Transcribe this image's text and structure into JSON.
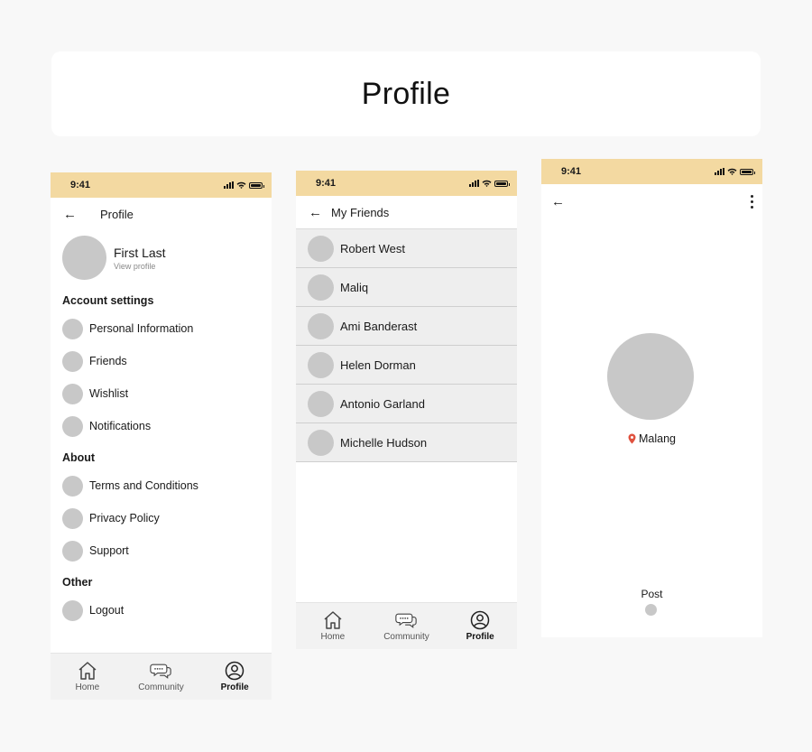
{
  "page": {
    "title": "Profile"
  },
  "status_bar": {
    "time": "9:41"
  },
  "profile_screen": {
    "header_title": "Profile",
    "user_name": "First Last",
    "view_profile": "View profile",
    "sections": [
      {
        "title": "Account settings",
        "items": [
          "Personal Information",
          "Friends",
          "Wishlist",
          "Notifications"
        ]
      },
      {
        "title": "About",
        "items": [
          "Terms and Conditions",
          "Privacy Policy",
          "Support"
        ]
      },
      {
        "title": "Other",
        "items": [
          "Logout"
        ]
      }
    ]
  },
  "friends_screen": {
    "header_title": "My Friends",
    "friends": [
      "Robert West",
      "Maliq",
      "Ami Banderast",
      "Helen Dorman",
      "Antonio Garland",
      "Michelle Hudson"
    ]
  },
  "user_screen": {
    "location": "Malang",
    "post_label": "Post"
  },
  "tab_bar": {
    "tabs": [
      {
        "label": "Home",
        "icon": "home-icon"
      },
      {
        "label": "Community",
        "icon": "chat-bubble-icon"
      },
      {
        "label": "Profile",
        "icon": "user-circle-icon",
        "active": true
      }
    ]
  },
  "colors": {
    "status_bar": "#f3d9a1",
    "location_pin": "#e0523f",
    "placeholder": "#c8c8c8"
  }
}
